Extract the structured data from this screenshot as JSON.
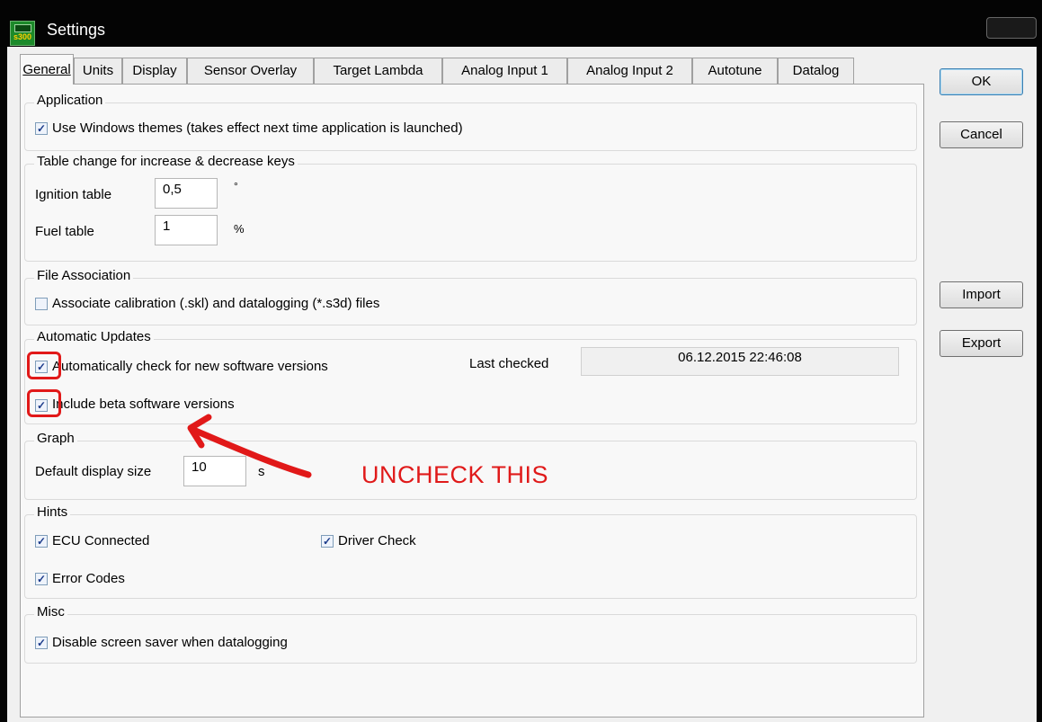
{
  "window": {
    "title": "Settings",
    "app_icon_text": "s300"
  },
  "tabs": [
    "General",
    "Units",
    "Display",
    "Sensor Overlay",
    "Target Lambda",
    "Analog Input 1",
    "Analog Input 2",
    "Autotune",
    "Datalog"
  ],
  "buttons": {
    "ok": "OK",
    "cancel": "Cancel",
    "import": "Import",
    "export": "Export"
  },
  "sections": {
    "application": {
      "legend": "Application",
      "use_themes": {
        "label": "Use Windows themes (takes effect next time application is launched)",
        "checked": true
      }
    },
    "table_change": {
      "legend": "Table change for increase & decrease keys",
      "ignition": {
        "label": "Ignition table",
        "value": "0,5",
        "unit": "°"
      },
      "fuel": {
        "label": "Fuel table",
        "value": "1",
        "unit": "%"
      }
    },
    "file_assoc": {
      "legend": "File Association",
      "associate": {
        "label": "Associate calibration (.skl) and datalogging (*.s3d) files",
        "checked": false
      }
    },
    "updates": {
      "legend": "Automatic Updates",
      "auto_check": {
        "label": "Automatically check for new software versions",
        "checked": true
      },
      "last_checked_label": "Last checked",
      "last_checked_value": "06.12.2015 22:46:08",
      "beta": {
        "label": "Include beta software versions",
        "checked": true
      }
    },
    "graph": {
      "legend": "Graph",
      "size_label": "Default display size",
      "size_value": "10",
      "size_unit": "s"
    },
    "hints": {
      "legend": "Hints",
      "ecu": {
        "label": "ECU Connected",
        "checked": true
      },
      "driver": {
        "label": "Driver Check",
        "checked": true
      },
      "errors": {
        "label": "Error Codes",
        "checked": true
      }
    },
    "misc": {
      "legend": "Misc",
      "screensaver": {
        "label": "Disable screen saver when datalogging",
        "checked": true
      }
    }
  },
  "annotation": {
    "text": "UNCHECK THIS",
    "color": "#e01a1a"
  },
  "colors": {
    "titlebar": "#040404",
    "panel": "#f8f8f8",
    "client": "#f0f0f0",
    "annotation": "#e11919"
  }
}
